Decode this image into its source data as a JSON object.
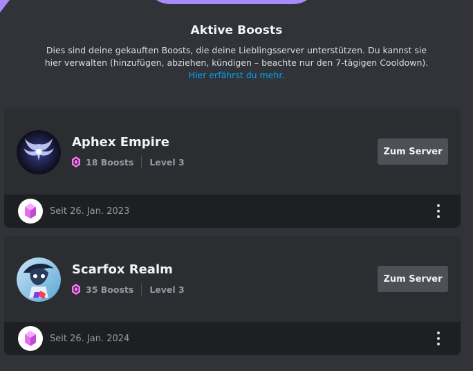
{
  "header": {
    "title": "Aktive Boosts",
    "description": "Dies sind deine gekauften Boosts, die deine Lieblingsserver unterstützen. Du kannst sie hier verwalten (hinzufügen, abziehen, kündigen – beachte nur den 7-tägigen Cooldown).",
    "learn_more": "Hier erfährst du mehr."
  },
  "servers": [
    {
      "name": "Aphex Empire",
      "boosts": "18 Boosts",
      "level": "Level 3",
      "button": "Zum Server",
      "since": "Seit 26. Jan. 2023",
      "icon": "aphex-empire-server-icon"
    },
    {
      "name": "Scarfox Realm",
      "boosts": "35 Boosts",
      "level": "Level 3",
      "button": "Zum Server",
      "since": "Seit 26. Jan. 2024",
      "icon": "scarfox-realm-server-icon"
    }
  ],
  "colors": {
    "background": "#313338",
    "card": "#2b2d31",
    "card_footer": "#1e1f22",
    "link": "#00a8fc",
    "boost_pink": "#ff73fa",
    "button": "#4e5058"
  },
  "icons": {
    "boost_gem": "boost-gem-icon",
    "more": "more-vertical-icon"
  }
}
